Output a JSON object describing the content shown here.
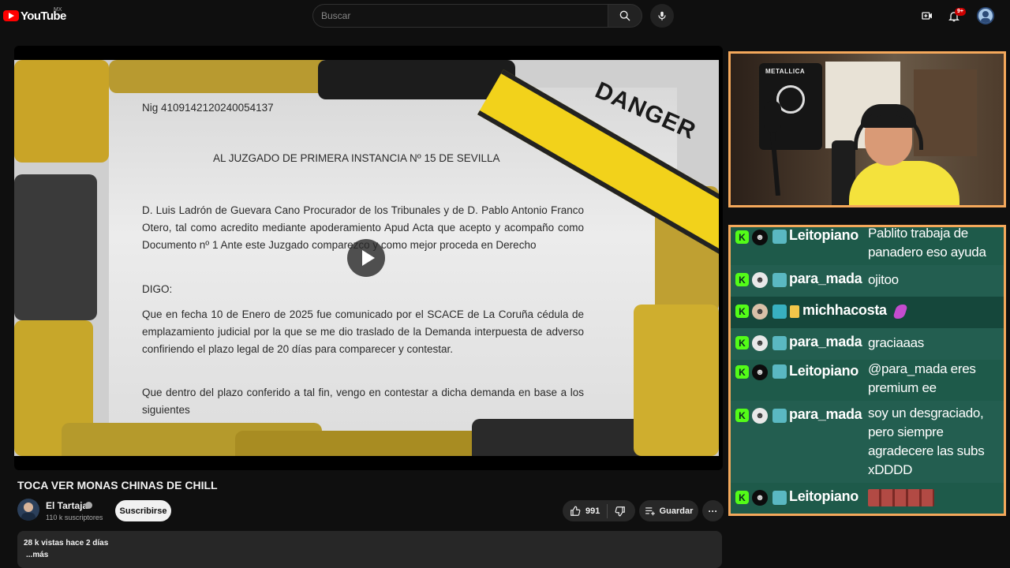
{
  "header": {
    "logo_text": "YouTube",
    "country_code": "MX",
    "search_placeholder": "Buscar",
    "notification_count": "9+"
  },
  "video": {
    "document": {
      "nig": "Nig 4109142120240054137",
      "heading": "AL JUZGADO DE PRIMERA INSTANCIA Nº 15 DE SEVILLA",
      "para1": "D. Luis Ladrón de Guevara Cano Procurador de los Tribunales y de D. Pablo Antonio Franco Otero, tal como acredito mediante apoderamiento Apud Acta que acepto y acompaño como Documento nº 1 Ante este Juzgado comparezco y como mejor proceda en Derecho",
      "digo": "DIGO:",
      "para2": "Que en fecha 10 de Enero de 2025 fue comunicado por el SCACE de La Coruña cédula de emplazamiento judicial por la que se me dio traslado de la Demanda interpuesta de adverso confiriendo el plazo legal de 20 días para comparecer y contestar.",
      "para3": "Que dentro del plazo conferido a tal fin, vengo en contestar a dicha demanda en base a los siguientes"
    },
    "danger_label": "DANGER",
    "title": "TOCA VER MONAS CHINAS DE CHILL"
  },
  "channel": {
    "name": "El Tartaja",
    "subscribers": "110 k suscriptores",
    "subscribe_label": "Suscribirse"
  },
  "actions": {
    "likes": "991",
    "save_label": "Guardar",
    "more_label": "···"
  },
  "description": {
    "meta": "28 k vistas  hace 2 días",
    "more": "...más"
  },
  "webcam": {
    "poster_text": "METALLICA"
  },
  "chat": {
    "messages": [
      {
        "user": "Leitopiano",
        "text": "Pablito trabaja de panadero eso ayuda"
      },
      {
        "user": "para_mada",
        "text": "ojitoo"
      },
      {
        "user": "michhacosta",
        "text": ""
      },
      {
        "user": "para_mada",
        "text": "graciaaas"
      },
      {
        "user": "Leitopiano",
        "text": "@para_mada eres premium ee"
      },
      {
        "user": "para_mada",
        "text": "soy un desgraciado, pero siempre agradecere las subs xDDDD"
      },
      {
        "user": "Leitopiano",
        "text": ""
      }
    ],
    "badge_letter": "K"
  },
  "colors": {
    "accent_orange": "#f4a85b",
    "kick_green": "#53fc18",
    "chat_bg": "#1e5a4a",
    "youtube_red": "#ff0000"
  },
  "icons": [
    "youtube-logo-icon",
    "search-icon",
    "mic-icon",
    "create-video-icon",
    "bell-icon",
    "like-icon",
    "dislike-icon",
    "save-playlist-icon",
    "play-icon",
    "kick-badge-icon",
    "verified-icon"
  ]
}
